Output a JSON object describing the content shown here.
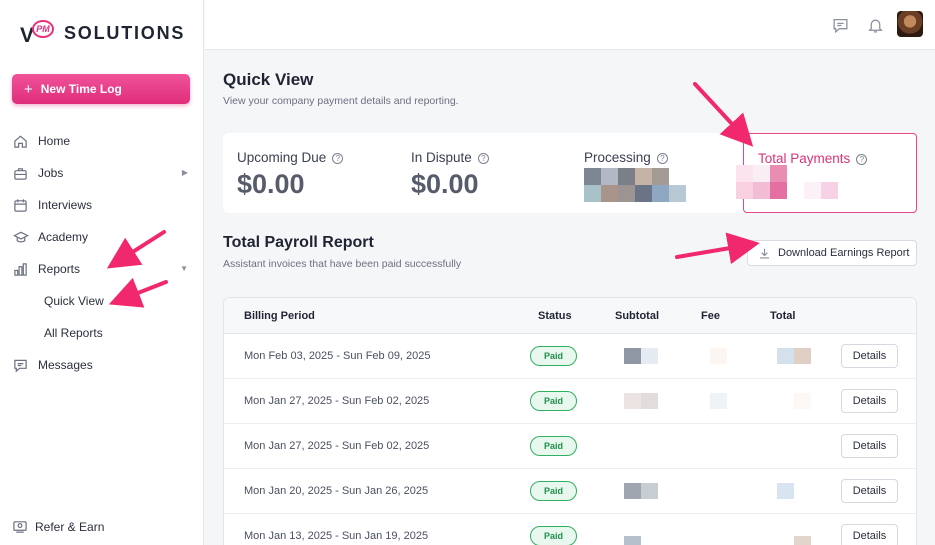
{
  "brand": {
    "logo_v": "V",
    "logo_pm": "PM",
    "logo_text": "SOLUTIONS"
  },
  "sidebar": {
    "new_button": "New Time Log",
    "items": [
      {
        "label": "Home",
        "icon": "home-icon"
      },
      {
        "label": "Jobs",
        "icon": "briefcase-icon",
        "expand": "right"
      },
      {
        "label": "Interviews",
        "icon": "calendar-icon"
      },
      {
        "label": "Academy",
        "icon": "graduation-cap-icon"
      },
      {
        "label": "Reports",
        "icon": "bar-chart-icon",
        "expand": "down"
      }
    ],
    "sub_items": [
      "Quick View",
      "All Reports"
    ],
    "messages": "Messages",
    "refer": "Refer & Earn"
  },
  "quick_view": {
    "title": "Quick View",
    "subtitle": "View your company payment details and reporting.",
    "stats": [
      {
        "label": "Upcoming Due",
        "value": "$0.00"
      },
      {
        "label": "In Dispute",
        "value": "$0.00"
      },
      {
        "label": "Processing",
        "value": ""
      },
      {
        "label": "Total Payments",
        "value": ""
      }
    ]
  },
  "report": {
    "title": "Total Payroll Report",
    "subtitle": "Assistant invoices that have been paid successfully",
    "download_label": "Download Earnings Report",
    "columns": [
      "Billing Period",
      "Status",
      "Subtotal",
      "Fee",
      "Total"
    ],
    "rows": [
      {
        "period": "Mon Feb 03, 2025 - Sun Feb 09, 2025",
        "status": "Paid",
        "action": "Details"
      },
      {
        "period": "Mon Jan 27, 2025 - Sun Feb 02, 2025",
        "status": "Paid",
        "action": "Details"
      },
      {
        "period": "Mon Jan 27, 2025 - Sun Feb 02, 2025",
        "status": "Paid",
        "action": "Details"
      },
      {
        "period": "Mon Jan 20, 2025 - Sun Jan 26, 2025",
        "status": "Paid",
        "action": "Details"
      },
      {
        "period": "Mon Jan 13, 2025 - Sun Jan 19, 2025",
        "status": "Paid",
        "action": "Details"
      }
    ]
  },
  "colors": {
    "accent": "#e8317b",
    "paid": "#2fb15f",
    "annotation_arrow": "#f2286e"
  }
}
